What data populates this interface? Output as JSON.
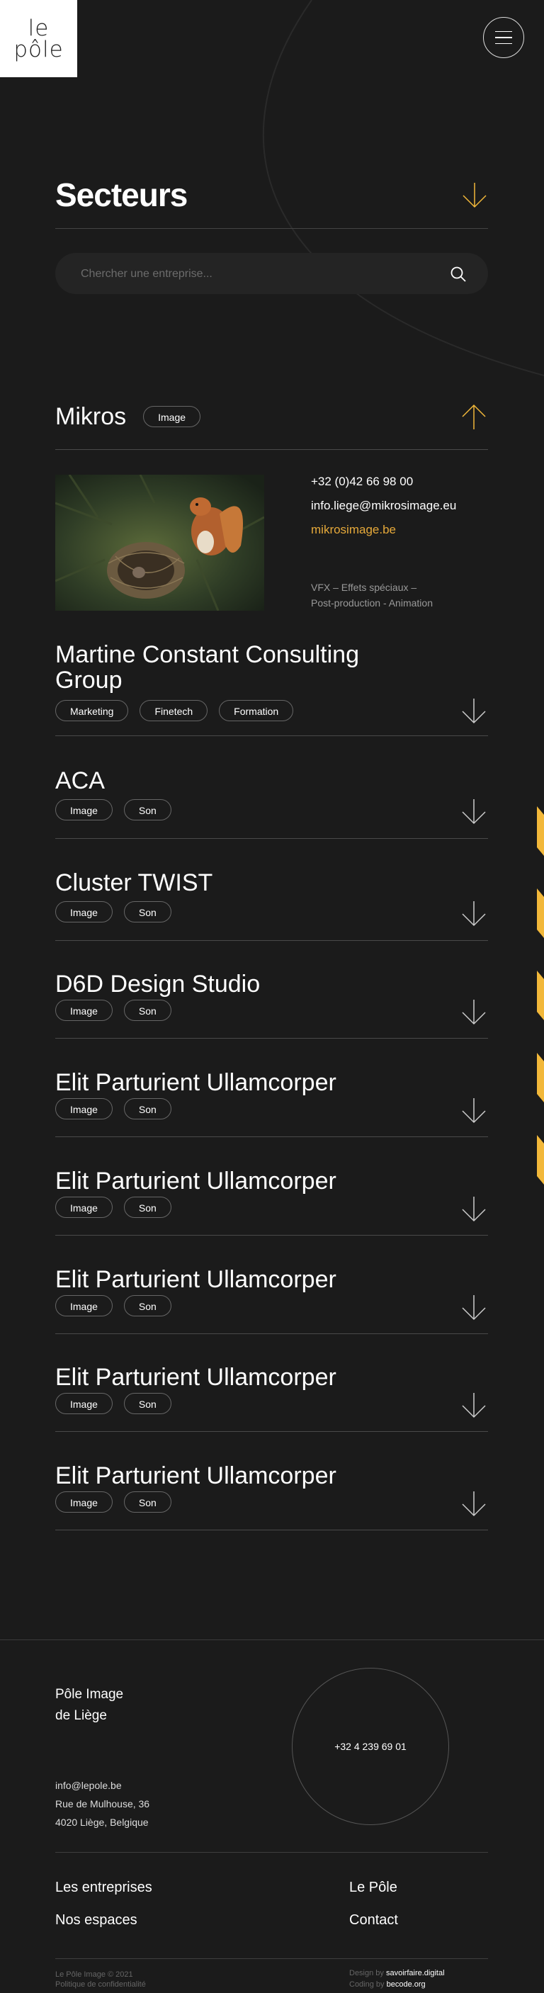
{
  "header": {
    "logo_line1": "le",
    "logo_line2": "pôle"
  },
  "page": {
    "title": "Secteurs"
  },
  "search": {
    "placeholder": "Chercher une entreprise..."
  },
  "colors": {
    "background": "#1b1b1b",
    "accent": "#f2b83a",
    "link": "#e6a93a"
  },
  "expanded": {
    "name": "Mikros",
    "tags": [
      "Image"
    ],
    "phone": "+32 (0)42 66 98 00",
    "email": "info.liege@mikrosimage.eu",
    "website": "mikrosimage.be",
    "desc_line1": "VFX – Effets spéciaux –",
    "desc_line2": "Post-production - Animation"
  },
  "companies": [
    {
      "name": "Martine Constant Consulting Group",
      "tags": [
        "Marketing",
        "Finetech",
        "Formation"
      ]
    },
    {
      "name": "ACA",
      "tags": [
        "Image",
        "Son"
      ]
    },
    {
      "name": "Cluster TWIST",
      "tags": [
        "Image",
        "Son"
      ]
    },
    {
      "name": "D6D Design Studio",
      "tags": [
        "Image",
        "Son"
      ]
    },
    {
      "name": "Elit Parturient Ullamcorper",
      "tags": [
        "Image",
        "Son"
      ]
    },
    {
      "name": "Elit Parturient Ullamcorper",
      "tags": [
        "Image",
        "Son"
      ]
    },
    {
      "name": "Elit Parturient Ullamcorper",
      "tags": [
        "Image",
        "Son"
      ]
    },
    {
      "name": "Elit Parturient Ullamcorper",
      "tags": [
        "Image",
        "Son"
      ]
    },
    {
      "name": "Elit Parturient Ullamcorper",
      "tags": [
        "Image",
        "Son"
      ]
    }
  ],
  "footer": {
    "title_line1": "Pôle Image",
    "title_line2": "de Liège",
    "phone": "+32 4 239 69 01",
    "email": "info@lepole.be",
    "address1": "Rue de Mulhouse, 36",
    "address2": "4020 Liège, Belgique",
    "nav": {
      "entreprises": "Les entreprises",
      "espaces": "Nos espaces",
      "pole": "Le Pôle",
      "contact": "Contact"
    },
    "copyright": "Le Pôle Image © 2021",
    "privacy": "Politique de confidentialité",
    "design_label": "Design by",
    "design_name": "savoirfaire.digital",
    "coding_label": "Coding by",
    "coding_name": "becode.org"
  }
}
